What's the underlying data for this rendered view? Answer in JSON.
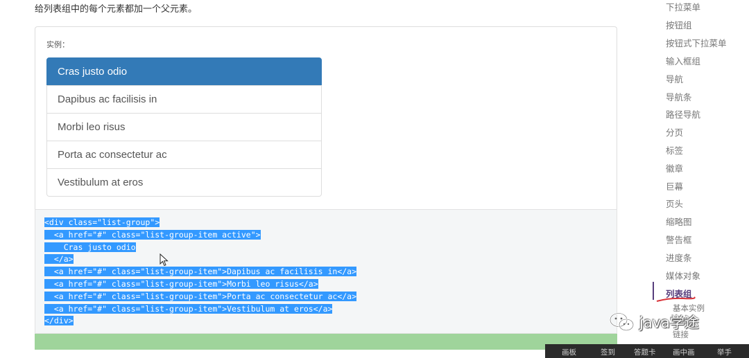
{
  "intro_text": "给列表组中的每个元素都加一个父元素。",
  "example": {
    "label": "实例：",
    "items": [
      {
        "text": "Cras justo odio",
        "active": true
      },
      {
        "text": "Dapibus ac facilisis in",
        "active": false
      },
      {
        "text": "Morbi leo risus",
        "active": false
      },
      {
        "text": "Porta ac consectetur ac",
        "active": false
      },
      {
        "text": "Vestibulum at eros",
        "active": false
      }
    ]
  },
  "code": {
    "lines": [
      "<div class=\"list-group\">",
      "  <a href=\"#\" class=\"list-group-item active\">",
      "    Cras justo odio",
      "  </a>",
      "  <a href=\"#\" class=\"list-group-item\">Dapibus ac facilisis in</a>",
      "  <a href=\"#\" class=\"list-group-item\">Morbi leo risus</a>",
      "  <a href=\"#\" class=\"list-group-item\">Porta ac consectetur ac</a>",
      "  <a href=\"#\" class=\"list-group-item\">Vestibulum at eros</a>",
      "</div>"
    ],
    "selection_color": "#3399ff"
  },
  "sidebar": {
    "items": [
      "下拉菜单",
      "按钮组",
      "按钮式下拉菜单",
      "输入框组",
      "导航",
      "导航条",
      "路径导航",
      "分页",
      "标签",
      "徽章",
      "巨幕",
      "页头",
      "缩略图",
      "警告框",
      "进度条",
      "媒体对象",
      "列表组"
    ],
    "active_item": "列表组",
    "subitems": [
      "基本实例",
      "徽章",
      "链接"
    ]
  },
  "watermark": {
    "text": "java学途",
    "icon": "wechat-icon"
  },
  "toolbar": {
    "items": [
      "画板",
      "签到",
      "答题卡",
      "画中画",
      "举手"
    ]
  },
  "colors": {
    "active": "#337ab7",
    "accent": "#563d7c",
    "green_bar": "#9fd49b"
  }
}
